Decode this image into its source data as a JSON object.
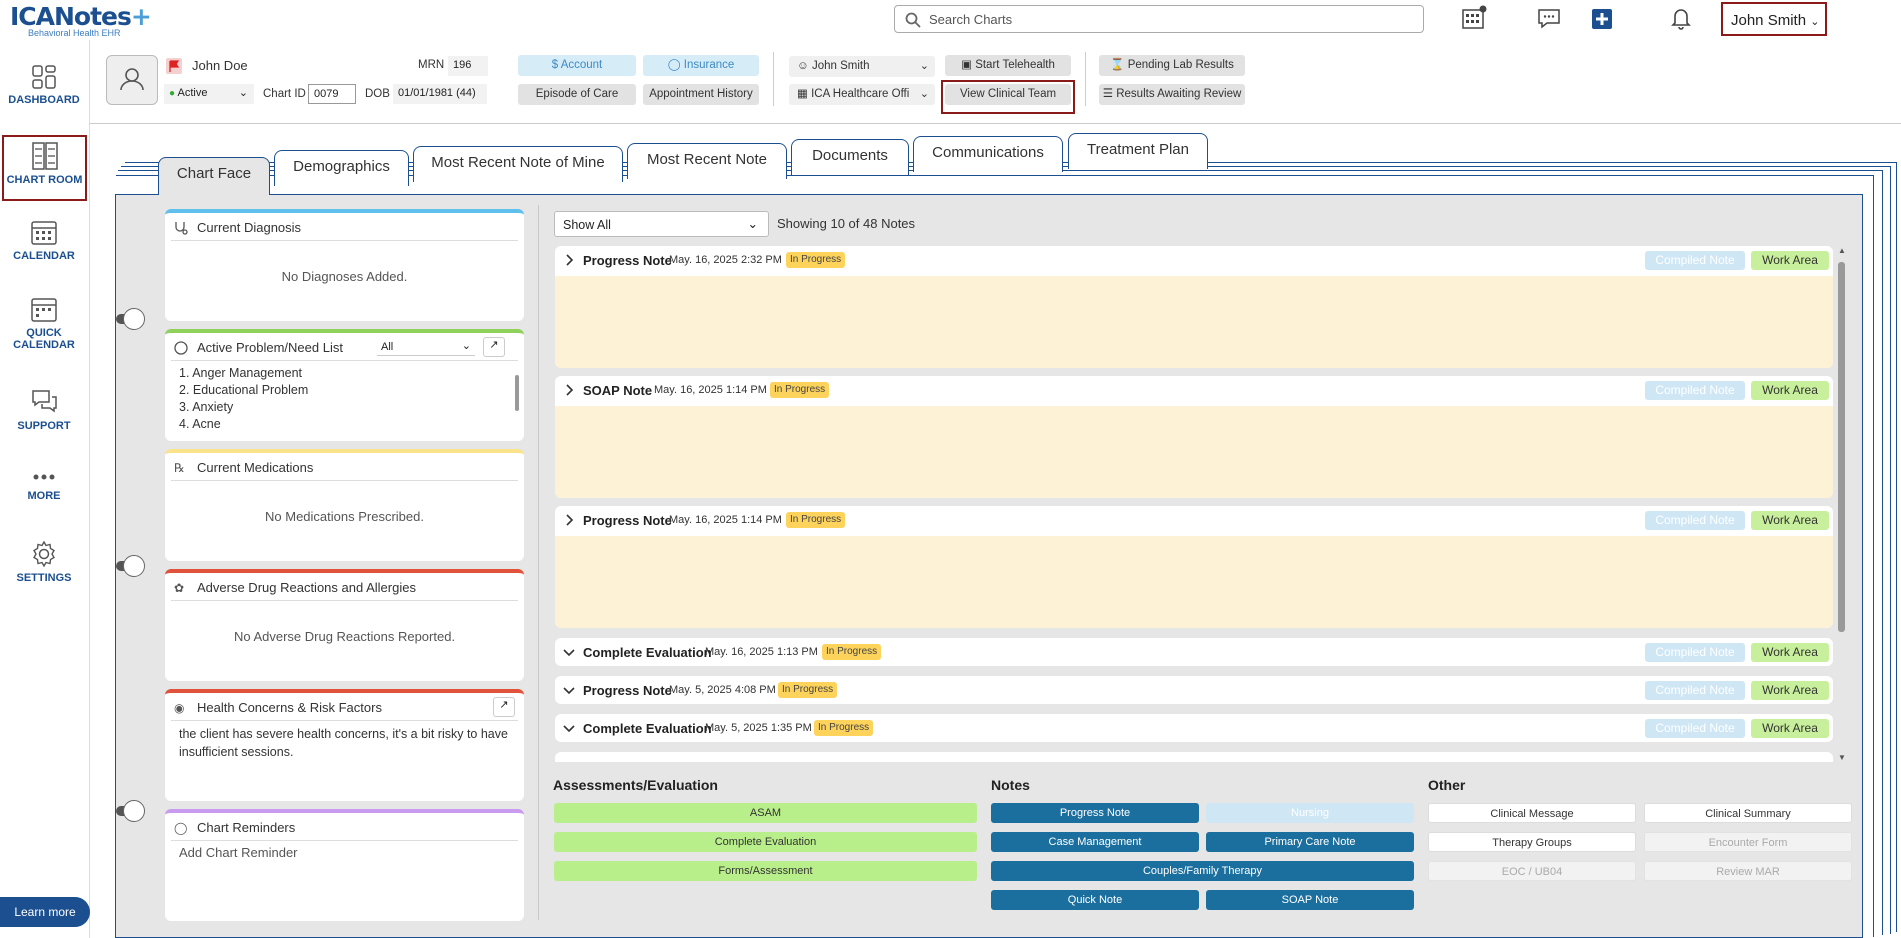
{
  "app": {
    "logo": "ICANotes",
    "logo_plus": "+",
    "tagline": "Behavioral Health EHR"
  },
  "search": {
    "placeholder": "Search Charts"
  },
  "user": {
    "name": "John Smith"
  },
  "sidebar": {
    "items": [
      {
        "label": "DASHBOARD"
      },
      {
        "label": "CHART ROOM"
      },
      {
        "label": "CALENDAR"
      },
      {
        "label": "QUICK CALENDAR"
      },
      {
        "label": "SUPPORT"
      },
      {
        "label": "MORE"
      },
      {
        "label": "SETTINGS"
      }
    ],
    "learn_more": "Learn more"
  },
  "patient": {
    "name": "John Doe",
    "status": "Active",
    "mrn_label": "MRN",
    "mrn": "196",
    "chart_id_label": "Chart ID",
    "chart_id": "0079",
    "dob_label": "DOB",
    "dob": "01/01/1981 (44)",
    "account": "Account",
    "insurance": "Insurance",
    "episode": "Episode of Care",
    "appointments": "Appointment History",
    "provider": "John Smith",
    "office": "ICA Healthcare Offi",
    "telehealth": "Start Telehealth",
    "clinical_team": "View Clinical Team",
    "pending_lab": "Pending Lab Results",
    "awaiting_review": "Results Awaiting Review"
  },
  "tabs": [
    "Chart Face",
    "Demographics",
    "Most Recent Note of Mine",
    "Most Recent Note",
    "Documents",
    "Communications",
    "Treatment Plan"
  ],
  "widgets": {
    "diagnosis": {
      "title": "Current Diagnosis",
      "empty": "No Diagnoses Added."
    },
    "problems": {
      "title": "Active Problem/Need List",
      "filter": "All",
      "items": [
        "1. Anger Management",
        "2. Educational Problem",
        "3. Anxiety",
        "4. Acne"
      ]
    },
    "medications": {
      "title": "Current Medications",
      "empty": "No Medications Prescribed."
    },
    "allergies": {
      "title": "Adverse Drug Reactions and Allergies",
      "empty": "No Adverse Drug Reactions Reported."
    },
    "health": {
      "title": "Health Concerns & Risk Factors",
      "text": "the client has severe health concerns, it's a bit risky to have insufficient sessions."
    },
    "reminders": {
      "title": "Chart Reminders",
      "placeholder": "Add Chart Reminder"
    }
  },
  "notes_filter": {
    "value": "Show All",
    "count": "Showing 10 of 48 Notes"
  },
  "notes": {
    "compiled_label": "Compiled Note",
    "work_label": "Work Area",
    "items": [
      {
        "type": "Progress Note",
        "date": "May. 16, 2025 2:32 PM",
        "status": "In Progress"
      },
      {
        "type": "SOAP Note",
        "date": "May. 16, 2025 1:14 PM",
        "status": "In Progress"
      },
      {
        "type": "Progress Note",
        "date": "May. 16, 2025 1:14 PM",
        "status": "In Progress"
      },
      {
        "type": "Complete Evaluation",
        "date": "May. 16, 2025 1:13 PM",
        "status": "In Progress"
      },
      {
        "type": "Progress Note",
        "date": "May. 5, 2025 4:08 PM",
        "status": "In Progress"
      },
      {
        "type": "Complete Evaluation",
        "date": "May. 5, 2025 1:35 PM",
        "status": "In Progress"
      }
    ]
  },
  "create": {
    "assess_title": "Assessments/Evaluation",
    "assess": [
      "ASAM",
      "Complete Evaluation",
      "Forms/Assessment"
    ],
    "notes_title": "Notes",
    "notes": [
      "Progress Note",
      "Nursing",
      "Case Management",
      "Primary Care Note",
      "Couples/Family Therapy",
      "Quick Note",
      "SOAP Note"
    ],
    "other_title": "Other",
    "other": [
      "Clinical Message",
      "Clinical Summary",
      "Therapy Groups",
      "Encounter Form",
      "EOC / UB04",
      "Review MAR"
    ]
  },
  "colors": {
    "brand": "#1b4f8f",
    "highlight_border": "#8b1a1a",
    "note_body": "#fdf2d5",
    "badge": "#fdd35c",
    "work_area": "#c7ef9c",
    "compiled": "#cfe7f5"
  }
}
